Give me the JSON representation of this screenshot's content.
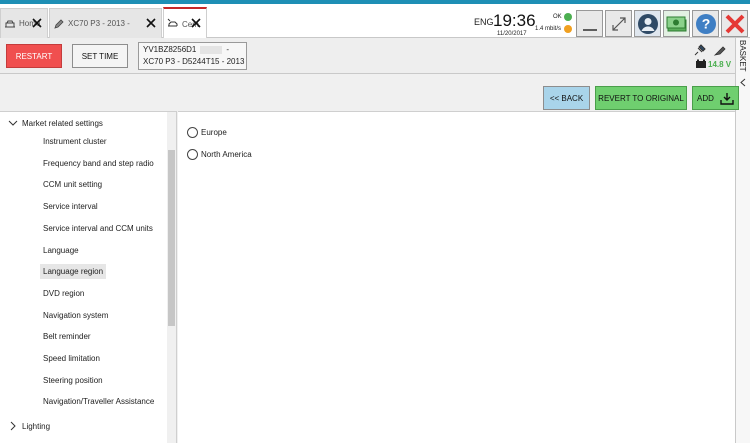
{
  "tabs": [
    {
      "label": "Home",
      "icon": "car-lift-icon"
    },
    {
      "label": "XC70 P3 - 2013 -",
      "icon": "pen-icon"
    },
    {
      "label": "Cem",
      "icon": "car-wrench-icon",
      "active": true
    }
  ],
  "status": {
    "language": "ENG",
    "time": "19:36",
    "date": "11/20/2017",
    "net_status": "OK",
    "net_speed": "1.4 mbit/s",
    "ok_color": "#4caf50",
    "speed_color": "#f0a020"
  },
  "toolbar": {
    "restart_label": "RESTART",
    "settime_label": "SET TIME",
    "vin": "YV1BZ8256D1",
    "vin_suffix": "-",
    "model": "XC70 P3 - D5244T15 - 2013",
    "battery_voltage": "14.8 V"
  },
  "basket": {
    "label": "BASKET"
  },
  "actions": {
    "back_label": "<< BACK",
    "revert_label": "REVERT TO ORIGINAL",
    "add_label": "ADD"
  },
  "tree": {
    "parent_expanded": "Market related settings",
    "items": [
      "Instrument cluster",
      "Frequency band and step radio",
      "CCM unit setting",
      "Service interval",
      "Service interval and CCM units",
      "Language",
      "Language region",
      "DVD region",
      "Navigation system",
      "Belt reminder",
      "Speed limitation",
      "Steering position",
      "Navigation/Traveller Assistance"
    ],
    "selected": "Language region",
    "parent_collapsed": "Lighting"
  },
  "options": [
    "Europe",
    "North America"
  ],
  "colors": {
    "accent": "#1e8fb5",
    "restart": "#f04f4f",
    "back": "#a9d4ea",
    "green_button": "#6fcf6f",
    "close_red": "#e53935"
  }
}
